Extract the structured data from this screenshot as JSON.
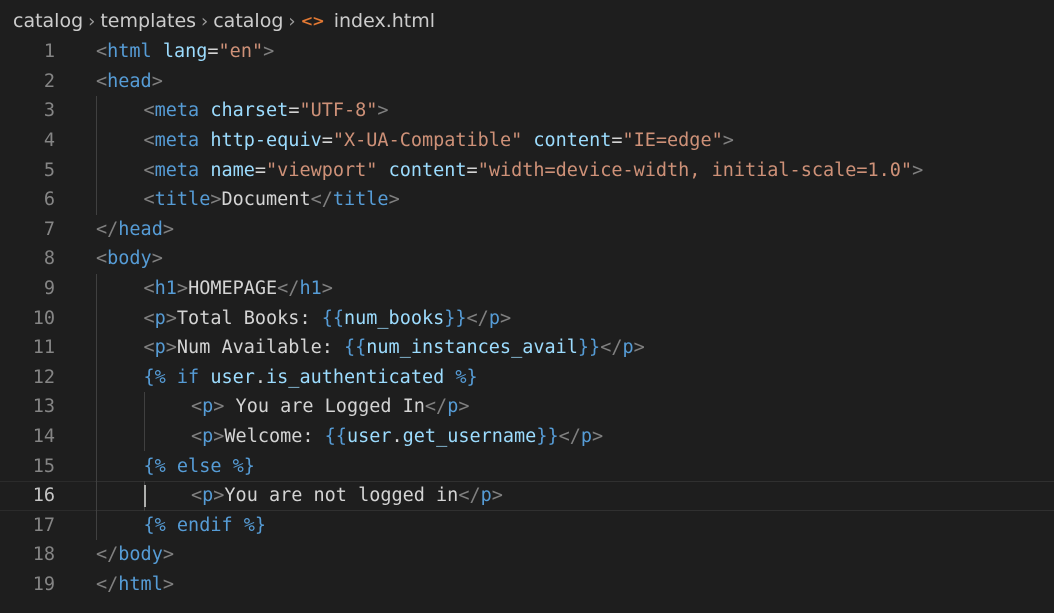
{
  "breadcrumb": {
    "parts": [
      "catalog",
      "templates",
      "catalog"
    ],
    "file_icon": "<>",
    "file_name": "index.html"
  },
  "editor": {
    "current_line": 16,
    "lines": [
      {
        "n": "1",
        "indent": 0,
        "tokens": [
          [
            "tg",
            "<"
          ],
          [
            "tn",
            "html"
          ],
          [
            "tx",
            " "
          ],
          [
            "an",
            "lang"
          ],
          [
            "tx",
            "="
          ],
          [
            "av",
            "\"en\""
          ],
          [
            "tg",
            ">"
          ]
        ]
      },
      {
        "n": "2",
        "indent": 0,
        "tokens": [
          [
            "tg",
            "<"
          ],
          [
            "tn",
            "head"
          ],
          [
            "tg",
            ">"
          ]
        ]
      },
      {
        "n": "3",
        "indent": 1,
        "tokens": [
          [
            "tg",
            "<"
          ],
          [
            "tn",
            "meta"
          ],
          [
            "tx",
            " "
          ],
          [
            "an",
            "charset"
          ],
          [
            "tx",
            "="
          ],
          [
            "av",
            "\"UTF-8\""
          ],
          [
            "tg",
            ">"
          ]
        ]
      },
      {
        "n": "4",
        "indent": 1,
        "tokens": [
          [
            "tg",
            "<"
          ],
          [
            "tn",
            "meta"
          ],
          [
            "tx",
            " "
          ],
          [
            "an",
            "http-equiv"
          ],
          [
            "tx",
            "="
          ],
          [
            "av",
            "\"X-UA-Compatible\""
          ],
          [
            "tx",
            " "
          ],
          [
            "an",
            "content"
          ],
          [
            "tx",
            "="
          ],
          [
            "av",
            "\"IE=edge\""
          ],
          [
            "tg",
            ">"
          ]
        ]
      },
      {
        "n": "5",
        "indent": 1,
        "tokens": [
          [
            "tg",
            "<"
          ],
          [
            "tn",
            "meta"
          ],
          [
            "tx",
            " "
          ],
          [
            "an",
            "name"
          ],
          [
            "tx",
            "="
          ],
          [
            "av",
            "\"viewport\""
          ],
          [
            "tx",
            " "
          ],
          [
            "an",
            "content"
          ],
          [
            "tx",
            "="
          ],
          [
            "av",
            "\"width=device-width, initial-scale=1.0\""
          ],
          [
            "tg",
            ">"
          ]
        ]
      },
      {
        "n": "6",
        "indent": 1,
        "tokens": [
          [
            "tg",
            "<"
          ],
          [
            "tn",
            "title"
          ],
          [
            "tg",
            ">"
          ],
          [
            "tx",
            "Document"
          ],
          [
            "tg",
            "</"
          ],
          [
            "tn",
            "title"
          ],
          [
            "tg",
            ">"
          ]
        ]
      },
      {
        "n": "7",
        "indent": 0,
        "tokens": [
          [
            "tg",
            "</"
          ],
          [
            "tn",
            "head"
          ],
          [
            "tg",
            ">"
          ]
        ]
      },
      {
        "n": "8",
        "indent": 0,
        "tokens": [
          [
            "tg",
            "<"
          ],
          [
            "tn",
            "body"
          ],
          [
            "tg",
            ">"
          ]
        ]
      },
      {
        "n": "9",
        "indent": 1,
        "tokens": [
          [
            "tg",
            "<"
          ],
          [
            "tn",
            "h1"
          ],
          [
            "tg",
            ">"
          ],
          [
            "tx",
            "HOMEPAGE"
          ],
          [
            "tg",
            "</"
          ],
          [
            "tn",
            "h1"
          ],
          [
            "tg",
            ">"
          ]
        ]
      },
      {
        "n": "10",
        "indent": 1,
        "tokens": [
          [
            "tg",
            "<"
          ],
          [
            "tn",
            "p"
          ],
          [
            "tg",
            ">"
          ],
          [
            "tx",
            "Total Books: "
          ],
          [
            "tm",
            "{{"
          ],
          [
            "tv",
            "num_books"
          ],
          [
            "tm",
            "}}"
          ],
          [
            "tg",
            "</"
          ],
          [
            "tn",
            "p"
          ],
          [
            "tg",
            ">"
          ]
        ]
      },
      {
        "n": "11",
        "indent": 1,
        "tokens": [
          [
            "tg",
            "<"
          ],
          [
            "tn",
            "p"
          ],
          [
            "tg",
            ">"
          ],
          [
            "tx",
            "Num Available: "
          ],
          [
            "tm",
            "{{"
          ],
          [
            "tv",
            "num_instances_avail"
          ],
          [
            "tm",
            "}}"
          ],
          [
            "tg",
            "</"
          ],
          [
            "tn",
            "p"
          ],
          [
            "tg",
            ">"
          ]
        ]
      },
      {
        "n": "12",
        "indent": 1,
        "tokens": [
          [
            "tm",
            "{% if "
          ],
          [
            "tv",
            "user"
          ],
          [
            "tp",
            "."
          ],
          [
            "tv",
            "is_authenticated"
          ],
          [
            "tm",
            " %}"
          ]
        ]
      },
      {
        "n": "13",
        "indent": 2,
        "tokens": [
          [
            "tg",
            "<"
          ],
          [
            "tn",
            "p"
          ],
          [
            "tg",
            ">"
          ],
          [
            "tx",
            " You are Logged In"
          ],
          [
            "tg",
            "</"
          ],
          [
            "tn",
            "p"
          ],
          [
            "tg",
            ">"
          ]
        ]
      },
      {
        "n": "14",
        "indent": 2,
        "tokens": [
          [
            "tg",
            "<"
          ],
          [
            "tn",
            "p"
          ],
          [
            "tg",
            ">"
          ],
          [
            "tx",
            "Welcome: "
          ],
          [
            "tm",
            "{{"
          ],
          [
            "tv",
            "user"
          ],
          [
            "tp",
            "."
          ],
          [
            "tv",
            "get_username"
          ],
          [
            "tm",
            "}}"
          ],
          [
            "tg",
            "</"
          ],
          [
            "tn",
            "p"
          ],
          [
            "tg",
            ">"
          ]
        ]
      },
      {
        "n": "15",
        "indent": 1,
        "tokens": [
          [
            "tm",
            "{% else %}"
          ]
        ]
      },
      {
        "n": "16",
        "indent": 2,
        "tokens": [
          [
            "tg",
            "<"
          ],
          [
            "tn",
            "p"
          ],
          [
            "tg",
            ">"
          ],
          [
            "tx",
            "You are not logged in"
          ],
          [
            "tg",
            "</"
          ],
          [
            "tn",
            "p"
          ],
          [
            "tg",
            ">"
          ]
        ]
      },
      {
        "n": "17",
        "indent": 1,
        "tokens": [
          [
            "tm",
            "{% endif %}"
          ]
        ]
      },
      {
        "n": "18",
        "indent": 0,
        "tokens": [
          [
            "tg",
            "</"
          ],
          [
            "tn",
            "body"
          ],
          [
            "tg",
            ">"
          ]
        ]
      },
      {
        "n": "19",
        "indent": 0,
        "tokens": [
          [
            "tg",
            "</"
          ],
          [
            "tn",
            "html"
          ],
          [
            "tg",
            ">"
          ]
        ]
      }
    ]
  },
  "colors": {
    "background": "#1e1e1e",
    "tag_bracket": "#808080",
    "tag_name": "#569cd6",
    "attribute_name": "#9cdcfe",
    "attribute_value": "#ce9178",
    "text": "#d4d4d4",
    "line_number": "#858585",
    "file_icon": "#e37933"
  }
}
